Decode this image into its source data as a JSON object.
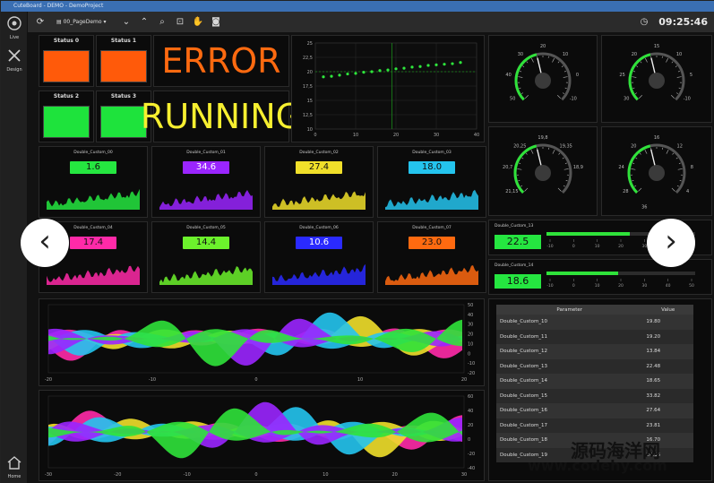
{
  "window": {
    "title": "CuteBoard - DEMO - DemoProject"
  },
  "toolbar": {
    "page_name": "00_PageDemo",
    "page_arrow": "▾",
    "time": "09:25:46"
  },
  "sidebar": {
    "items": [
      {
        "label": "Live",
        "icon": "eye-icon"
      },
      {
        "label": "Design",
        "icon": "tools-icon"
      },
      {
        "label": "Home",
        "icon": "home-icon"
      }
    ]
  },
  "status": [
    {
      "label": "Status 0",
      "color": "#ff5a0a"
    },
    {
      "label": "Status 1",
      "color": "#ff5a0a"
    },
    {
      "label": "Status 2",
      "color": "#1ee33c"
    },
    {
      "label": "Status 3",
      "color": "#1ee33c"
    }
  ],
  "messages": {
    "error": "ERROR",
    "running": "RUNNING",
    "error_color": "#ff6a10",
    "running_color": "#f6ef30"
  },
  "scatter": {
    "yticks": [
      "25",
      "22,5",
      "20",
      "17,5",
      "15",
      "12,5",
      "10"
    ],
    "xticks": [
      "0",
      "10",
      "20",
      "30",
      "40"
    ],
    "chart_data": {
      "type": "scatter",
      "x": [
        2,
        4,
        6,
        8,
        10,
        12,
        14,
        16,
        18,
        20,
        22,
        24,
        26,
        28,
        30,
        32,
        34,
        36
      ],
      "y": [
        19.1,
        19.2,
        19.4,
        19.6,
        19.7,
        19.9,
        20.0,
        20.2,
        20.3,
        20.5,
        20.6,
        20.8,
        20.9,
        21.1,
        21.2,
        21.3,
        21.4,
        21.6
      ],
      "xlim": [
        0,
        40
      ],
      "ylim": [
        10,
        25
      ]
    }
  },
  "gauges": [
    {
      "ticks": [
        "20",
        "30",
        "10",
        "40",
        "0",
        "50",
        "-10"
      ],
      "value": 0
    },
    {
      "ticks": [
        "15",
        "20",
        "10",
        "25",
        "5",
        "30",
        "-10"
      ],
      "value": 20
    },
    {
      "ticks": [
        "19,8",
        "20,25",
        "19,35",
        "20,7",
        "18,9",
        "21,15"
      ],
      "value": 20.2
    },
    {
      "ticks": [
        "16",
        "20",
        "12",
        "24",
        "8",
        "28",
        "4",
        "36"
      ],
      "value": 20.5
    }
  ],
  "customs": [
    {
      "label": "Double_Custom_00",
      "value": "1.6",
      "bg": "#25e640",
      "fg": "#111"
    },
    {
      "label": "Double_Custom_01",
      "value": "34.6",
      "bg": "#9a25ff",
      "fg": "#fff"
    },
    {
      "label": "Double_Custom_02",
      "value": "27.4",
      "bg": "#f0df2a",
      "fg": "#111"
    },
    {
      "label": "Double_Custom_03",
      "value": "18.0",
      "bg": "#24c4ee",
      "fg": "#111"
    },
    {
      "label": "Double_Custom_04",
      "value": "17.4",
      "bg": "#ff2aa8",
      "fg": "#111"
    },
    {
      "label": "Double_Custom_05",
      "value": "14.4",
      "bg": "#6cf22c",
      "fg": "#111"
    },
    {
      "label": "Double_Custom_06",
      "value": "10.6",
      "bg": "#2a2aff",
      "fg": "#fff"
    },
    {
      "label": "Double_Custom_07",
      "value": "23.0",
      "bg": "#ff6a10",
      "fg": "#111"
    }
  ],
  "bars": [
    {
      "label": "Double_Custom_13",
      "value": "22.5",
      "fill": 0.56,
      "ticks": [
        "-10",
        "0",
        "10",
        "20",
        "30",
        "40",
        "50"
      ]
    },
    {
      "label": "Double_Custom_14",
      "value": "18.6",
      "fill": 0.48,
      "ticks": [
        "-10",
        "0",
        "10",
        "20",
        "30",
        "40",
        "50"
      ]
    }
  ],
  "wave1": {
    "yticks": [
      "50",
      "40",
      "30",
      "20",
      "10",
      "0",
      "-10",
      "-20"
    ],
    "xticks": [
      "-20",
      "-10",
      "0",
      "10",
      "20"
    ]
  },
  "wave2": {
    "yticks": [
      "60",
      "40",
      "20",
      "0",
      "-20",
      "-40"
    ],
    "xticks": [
      "-30",
      "-20",
      "-10",
      "0",
      "10",
      "20",
      "30"
    ]
  },
  "table": {
    "headers": [
      "Parameter",
      "Value"
    ],
    "rows": [
      [
        "Double_Custom_10",
        "19.80"
      ],
      [
        "Double_Custom_11",
        "19.20"
      ],
      [
        "Double_Custom_12",
        "13.84"
      ],
      [
        "Double_Custom_13",
        "22.48"
      ],
      [
        "Double_Custom_14",
        "18.65"
      ],
      [
        "Double_Custom_15",
        "33.82"
      ],
      [
        "Double_Custom_16",
        "27.64"
      ],
      [
        "Double_Custom_17",
        "23.81"
      ],
      [
        "Double_Custom_18",
        "16.70"
      ],
      [
        "Double_Custom_19",
        "20.35"
      ]
    ]
  },
  "watermark": {
    "line1": "源码海洋网",
    "line2": "www.codehy.com"
  },
  "nav": {
    "prev": "‹",
    "next": "›"
  }
}
